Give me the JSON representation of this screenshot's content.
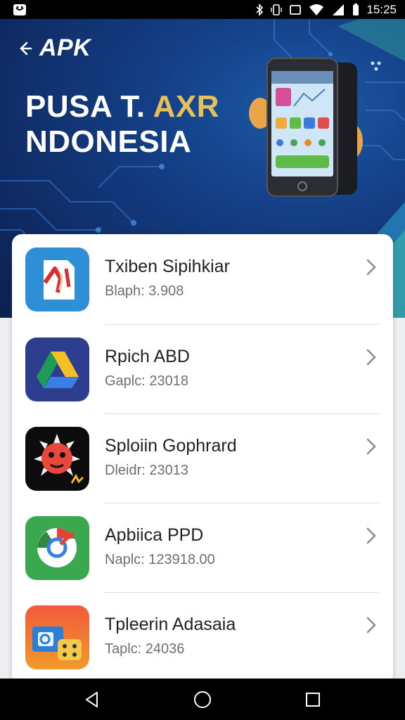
{
  "status_bar": {
    "time": "15:25"
  },
  "header": {
    "back_label": "APK"
  },
  "hero": {
    "title_line1_part1": "PUSA T. ",
    "title_line1_accent": "AXR",
    "title_line2": "NDONESIA"
  },
  "apps": [
    {
      "name": "Txiben Sipihkiar",
      "meta": "Blaph: 3.908",
      "icon": "pdf-document-icon"
    },
    {
      "name": "Rpich ABD",
      "meta": "Gaplc: 23018",
      "icon": "drive-triangle-icon"
    },
    {
      "name": "Sploiin Gophrard",
      "meta": "Dleidr: 23013",
      "icon": "red-monster-icon"
    },
    {
      "name": "Apbiica PPD",
      "meta": "Naplc: 123918.00",
      "icon": "chrome-browser-icon"
    },
    {
      "name": "Tpleerin Adasaia",
      "meta": "Taplc: 24036",
      "icon": "photo-game-icon"
    }
  ],
  "colors": {
    "hero_bg": "#143f86",
    "accent": "#e8c05a",
    "card_bg": "#ffffff"
  }
}
